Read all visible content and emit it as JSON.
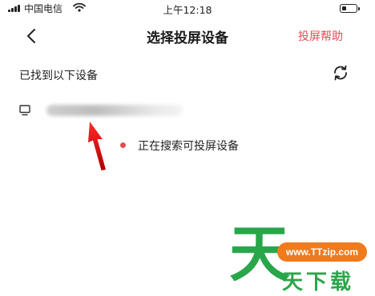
{
  "status_bar": {
    "carrier": "中国电信",
    "time": "上午12:18",
    "battery_level": 0.3
  },
  "nav": {
    "title": "选择投屏设备",
    "help_label": "投屏帮助"
  },
  "devices": {
    "found_label": "已找到以下设备"
  },
  "searching": {
    "text": "正在搜索可投屏设备"
  },
  "watermark": {
    "big_char": "天",
    "url": "www.TTzip.com",
    "text": "天下载"
  },
  "colors": {
    "accent": "#e84a55",
    "watermark_green": "#2aa64a",
    "watermark_orange": "#f07b1c"
  }
}
